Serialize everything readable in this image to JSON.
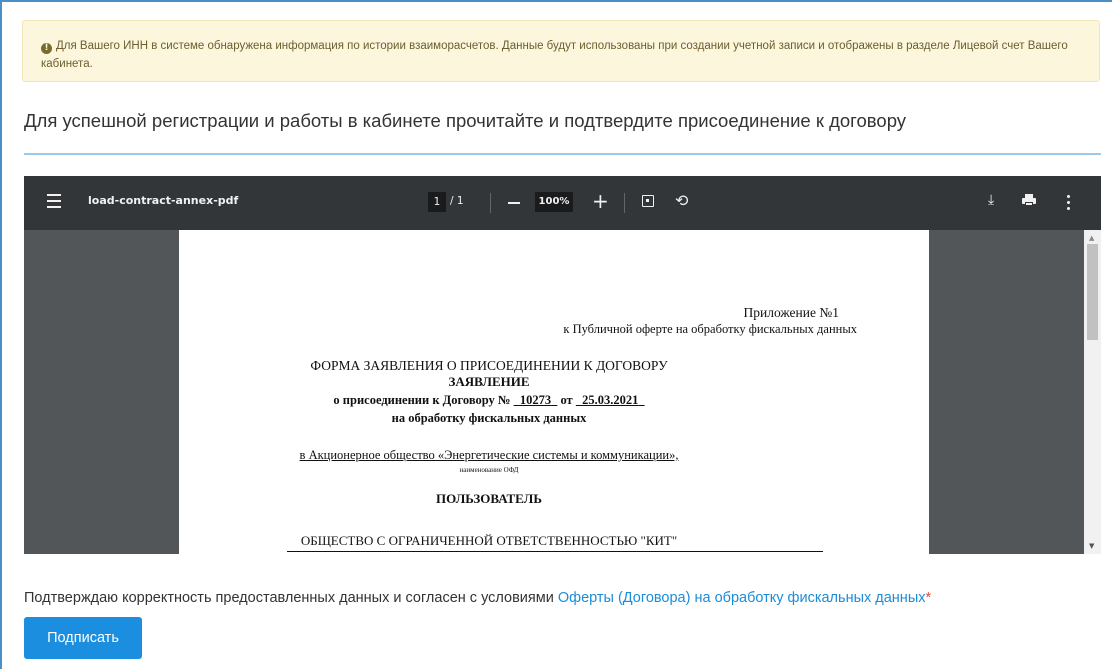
{
  "alert": {
    "icon": "info-circle-icon",
    "text": "Для Вашего ИНН в системе обнаружена информация по истории взаиморасчетов. Данные будут использованы при создании учетной записи и отображены в разделе Лицевой счет Вашего кабинета."
  },
  "heading": "Для успешной регистрации и работы в кабинете прочитайте и подтвердите присоединение к договору",
  "viewer": {
    "title": "load-contract-annex-pdf",
    "page_current": "1",
    "page_total": "/ 1",
    "zoom": "100%",
    "icons": [
      "menu-icon",
      "zoom-out-icon",
      "zoom-in-icon",
      "fit-page-icon",
      "rotate-icon",
      "download-icon",
      "print-icon",
      "more-options-icon"
    ]
  },
  "document": {
    "annex_label": "Приложение №1",
    "annex_to": "к Публичной оферте на обработку фискальных данных",
    "form_title": "ФОРМА ЗАЯВЛЕНИЯ О ПРИСОЕДИНЕНИИ К ДОГОВОРУ",
    "statement": "ЗАЯВЛЕНИЕ",
    "contract_prefix": "о присоединении к Договору №",
    "contract_number": "10273",
    "contract_from": "от",
    "contract_date": "25.03.2021",
    "fiscal_line": "на обработку фискальных данных",
    "operator": "в Акционерное общество «Энергетические системы и коммуникации»,",
    "operator_caption": "наименование ОФД",
    "user_header": "ПОЛЬЗОВАТЕЛЬ",
    "user_company": "ОБЩЕСТВО С ОГРАНИЧЕННОЙ ОТВЕТСТВЕННОСТЬЮ \"КИТ\""
  },
  "consent": {
    "text": "Подтверждаю корректность предоставленных данных и согласен с условиями ",
    "link": "Оферты (Договора) на обработку фискальных данных",
    "required_mark": "*"
  },
  "sign_button": "Подписать",
  "colors": {
    "accent": "#1b8ee0",
    "link": "#1b8dd8",
    "alert_bg": "#fcf6dc",
    "viewer_toolbar": "#323639",
    "viewer_bg": "#525659"
  }
}
